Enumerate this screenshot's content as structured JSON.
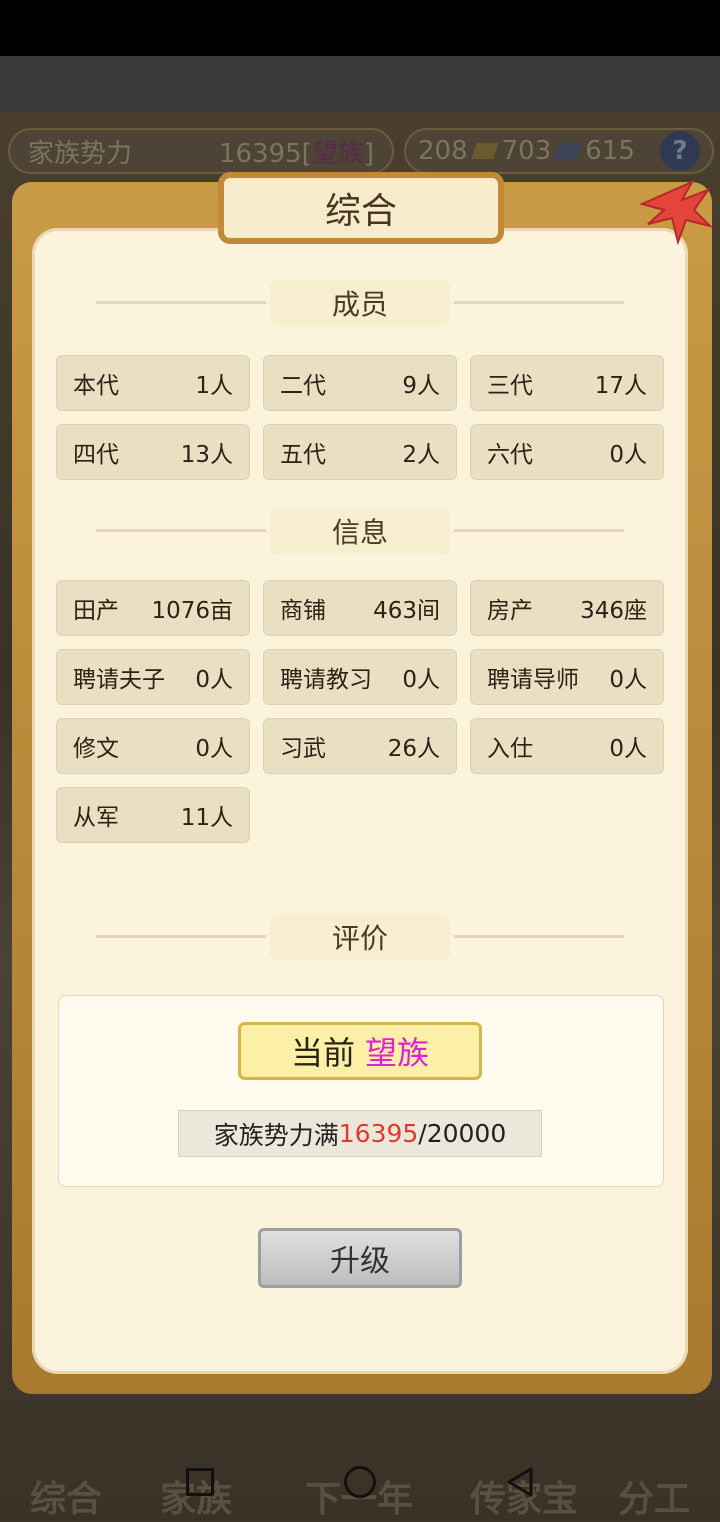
{
  "topbar": {
    "left_label": "家族势力",
    "left_value": "16395",
    "left_bracket_open": "[",
    "left_rank": "望族",
    "left_bracket_close": "]",
    "res1": "208",
    "res2": "703",
    "res3": "615",
    "help": "?"
  },
  "dialog": {
    "title": "综合",
    "sections": {
      "members": "成员",
      "info": "信息",
      "evaluation": "评价"
    }
  },
  "members": [
    {
      "label": "本代",
      "value": "1人"
    },
    {
      "label": "二代",
      "value": "9人"
    },
    {
      "label": "三代",
      "value": "17人"
    },
    {
      "label": "四代",
      "value": "13人"
    },
    {
      "label": "五代",
      "value": "2人"
    },
    {
      "label": "六代",
      "value": "0人"
    }
  ],
  "info": [
    {
      "label": "田产",
      "value": "1076亩"
    },
    {
      "label": "商铺",
      "value": "463间"
    },
    {
      "label": "房产",
      "value": "346座"
    },
    {
      "label": "聘请夫子",
      "value": "0人"
    },
    {
      "label": "聘请教习",
      "value": "0人"
    },
    {
      "label": "聘请导师",
      "value": "0人"
    },
    {
      "label": "修文",
      "value": "0人"
    },
    {
      "label": "习武",
      "value": "26人"
    },
    {
      "label": "入仕",
      "value": "0人"
    },
    {
      "label": "从军",
      "value": "11人"
    }
  ],
  "evaluation": {
    "current_prefix": "当前",
    "current_rank": "望族",
    "power_prefix": "家族势力满",
    "power_current": "16395",
    "power_max": "/20000",
    "upgrade_label": "升级"
  },
  "bottom_nav": [
    "综合",
    "家族",
    "下一年",
    "传家宝",
    "分工"
  ],
  "colors": {
    "rank_highlight": "#e020d8",
    "power_current": "#e03a2a",
    "panel_bg": "#fbf3dc"
  }
}
